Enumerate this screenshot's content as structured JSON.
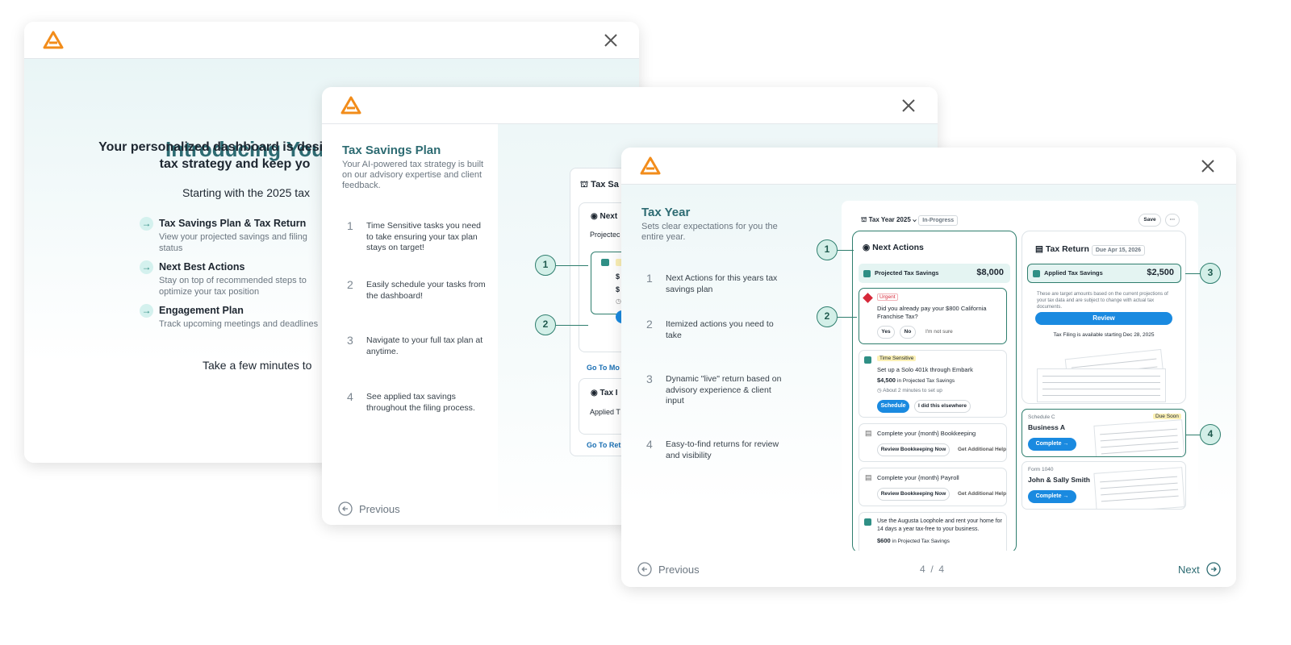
{
  "brand": {
    "accent": "#f28c1a",
    "teal": "#2d6b72",
    "primary_blue": "#1a8ae0",
    "callout_green": "#2f7e6e"
  },
  "modal1": {
    "title": "Introducing You",
    "subtitle_line1": "Your personalized dashboard is desig",
    "subtitle_line2": "tax strategy and keep yo",
    "starting": "Starting with the 2025 tax",
    "items": [
      {
        "title": "Tax Savings Plan & Tax Return",
        "desc": "View your projected savings and filing status"
      },
      {
        "title": "Next Best Actions",
        "desc": "Stay on top of recommended steps to optimize your tax position"
      },
      {
        "title": "Engagement Plan",
        "desc": "Track upcoming meetings and deadlines"
      }
    ],
    "take": "Take a few minutes to"
  },
  "modal2": {
    "title": "Tax Savings Plan",
    "desc": "Your AI-powered tax strategy is built on our advisory expertise and client feedback.",
    "steps": [
      {
        "n": "1",
        "text": "Time Sensitive tasks you need to take ensuring your tax plan stays on target!"
      },
      {
        "n": "2",
        "text": "Easily schedule your tasks from the dashboard!"
      },
      {
        "n": "3",
        "text": "Navigate to your full tax plan at anytime."
      },
      {
        "n": "4",
        "text": "See applied tax savings throughout the filing process."
      }
    ],
    "preview": {
      "header": "Tax Sa",
      "next": "Next",
      "projected": "Projectec",
      "s1": "$",
      "s2": "$",
      "goto1": "Go To Mo",
      "tax": "Tax I",
      "applied": "Applied T",
      "goto2": "Go To Ret"
    },
    "callouts": [
      "1",
      "2"
    ],
    "previous": "Previous"
  },
  "modal3": {
    "title": "Tax Year",
    "desc": "Sets clear expectations for you the entire year.",
    "steps": [
      {
        "n": "1",
        "text": "Next Actions for this years tax savings plan"
      },
      {
        "n": "2",
        "text": "Itemized actions you need to take"
      },
      {
        "n": "3",
        "text": "Dynamic \"live\" return based on advisory experience & client input"
      },
      {
        "n": "4",
        "text": "Easy-to-find returns for review and visibility"
      }
    ],
    "callouts": [
      "1",
      "2",
      "3",
      "4"
    ],
    "dashboard": {
      "tax_year": "Tax Year 2025",
      "status": "In-Progress",
      "save": "Save",
      "more": "···",
      "next_actions": "Next Actions",
      "projected_label": "Projected Tax Savings",
      "projected_value": "$8,000",
      "urgent_badge": "Urgent",
      "urgent_q": "Did you already pay your $800 California Franchise Tax?",
      "yes": "Yes",
      "no": "No",
      "not_sure": "I'm not sure",
      "ts_badge": "Time Sensitive",
      "ts_title": "Set up a Solo 401k through Embark",
      "ts_value": "$4,500",
      "ts_suffix": "in Projected Tax Savings",
      "ts_time": "About 2 minutes to set up",
      "schedule": "Schedule",
      "did_elsewhere": "I did this elsewhere",
      "bk_title": "Complete your {month} Bookkeeping",
      "bk_review": "Review Bookkeeping Now",
      "bk_help": "Get Additional Help",
      "pr_title": "Complete your {month} Payroll",
      "pr_review": "Review Bookkeeping Now",
      "pr_help": "Get Additional Help",
      "aug_title": "Use the Augusta Loophole and rent your home for 14 days a year tax-free to your business.",
      "aug_value": "$600",
      "aug_suffix": "in Projected Tax Savings",
      "tax_return": "Tax Return",
      "due": "Due Apr 15, 2026",
      "applied_label": "Applied Tax Savings",
      "applied_value": "$2,500",
      "note": "These are target amounts based on the current projections of your tax data and are subject to change with actual tax documents.",
      "review": "Review",
      "filing": "Tax Filing is available starting Dec 28, 2025",
      "sched_c": "Schedule C",
      "due_soon": "Due Soon",
      "business": "Business A",
      "complete1": "Complete  →",
      "form1040": "Form 1040",
      "john": "John & Sally Smith",
      "complete2": "Complete  →"
    },
    "previous": "Previous",
    "page": "4  /  4",
    "next": "Next"
  }
}
